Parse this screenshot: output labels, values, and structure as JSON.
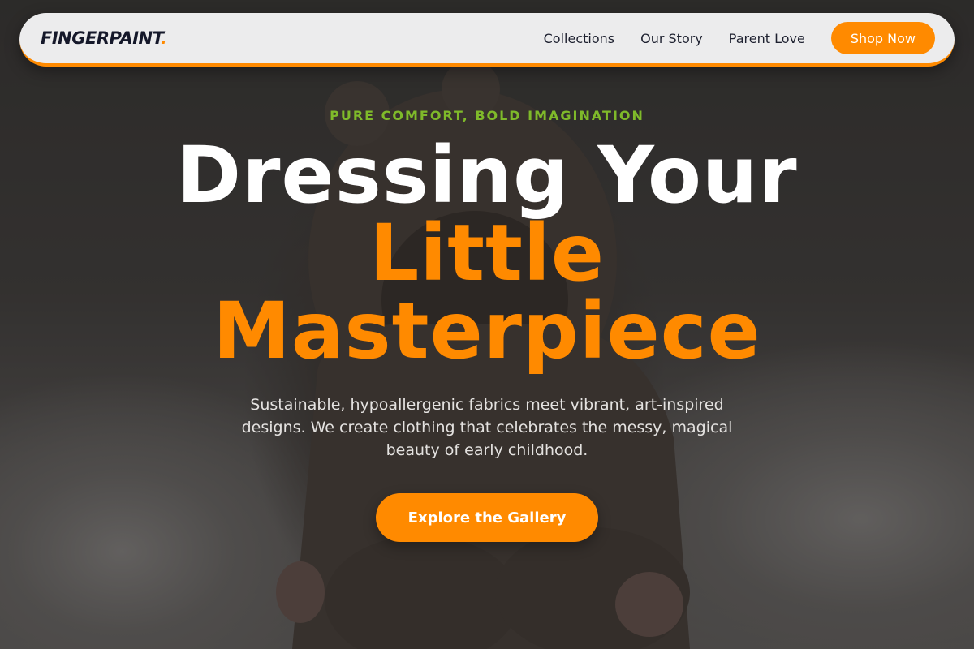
{
  "nav": {
    "logo_text": "FINGERPAINT",
    "logo_dot": ".",
    "links": [
      "Collections",
      "Our Story",
      "Parent Love"
    ],
    "cta_label": "Shop Now"
  },
  "hero": {
    "eyebrow": "PURE COMFORT, BOLD IMAGINATION",
    "headline_line1": "Dressing Your",
    "headline_line2": "Little",
    "headline_line3": "Masterpiece",
    "description": "Sustainable, hypoallergenic fabrics meet vibrant, art-inspired designs. We create clothing that celebrates the messy, magical beauty of early childhood.",
    "cta_label": "Explore the Gallery"
  },
  "colors": {
    "accent": "#ff8a00",
    "eyebrow": "#7fba2a",
    "logo": "#15182a",
    "nav_bg": "#ececed"
  }
}
